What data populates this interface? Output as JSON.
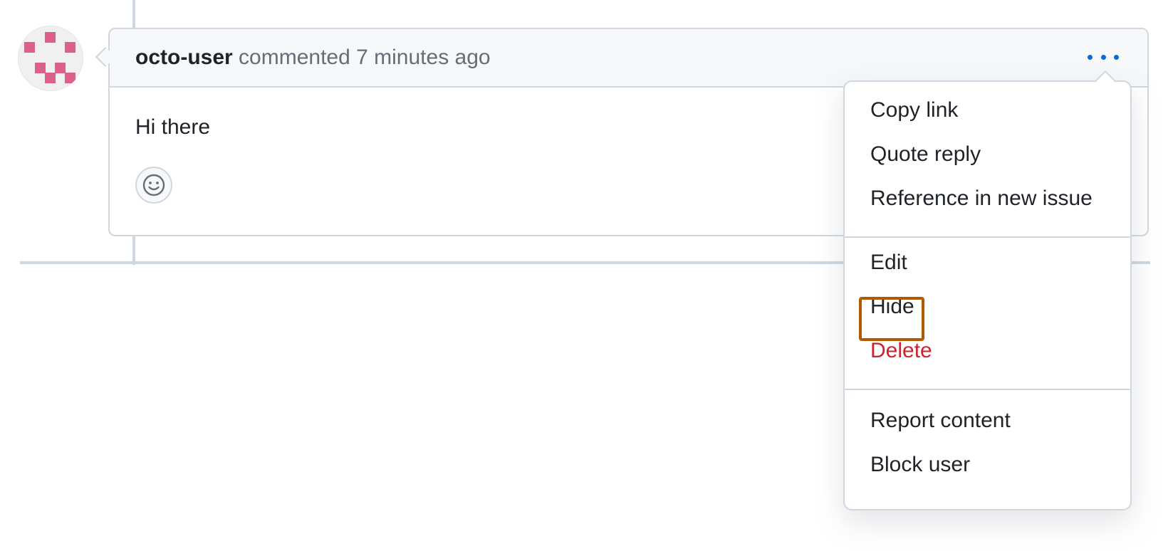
{
  "comment": {
    "author": "octo-user",
    "action": "commented",
    "timestamp": "7 minutes ago",
    "body": "Hi there",
    "menu_icon": "kebab-horizontal-icon",
    "reaction_icon": "smiley-icon"
  },
  "menu": {
    "sections": [
      {
        "items": [
          {
            "label": "Copy link"
          },
          {
            "label": "Quote reply"
          },
          {
            "label": "Reference in new issue"
          }
        ]
      },
      {
        "items": [
          {
            "label": "Edit"
          },
          {
            "label": "Hide"
          },
          {
            "label": "Delete"
          }
        ]
      },
      {
        "items": [
          {
            "label": "Report content"
          },
          {
            "label": "Block user"
          }
        ]
      }
    ]
  },
  "colors": {
    "accent": "#0969da",
    "danger": "#cf222e",
    "highlight": "#b35900",
    "avatar_pixel": "#de5e8c"
  }
}
